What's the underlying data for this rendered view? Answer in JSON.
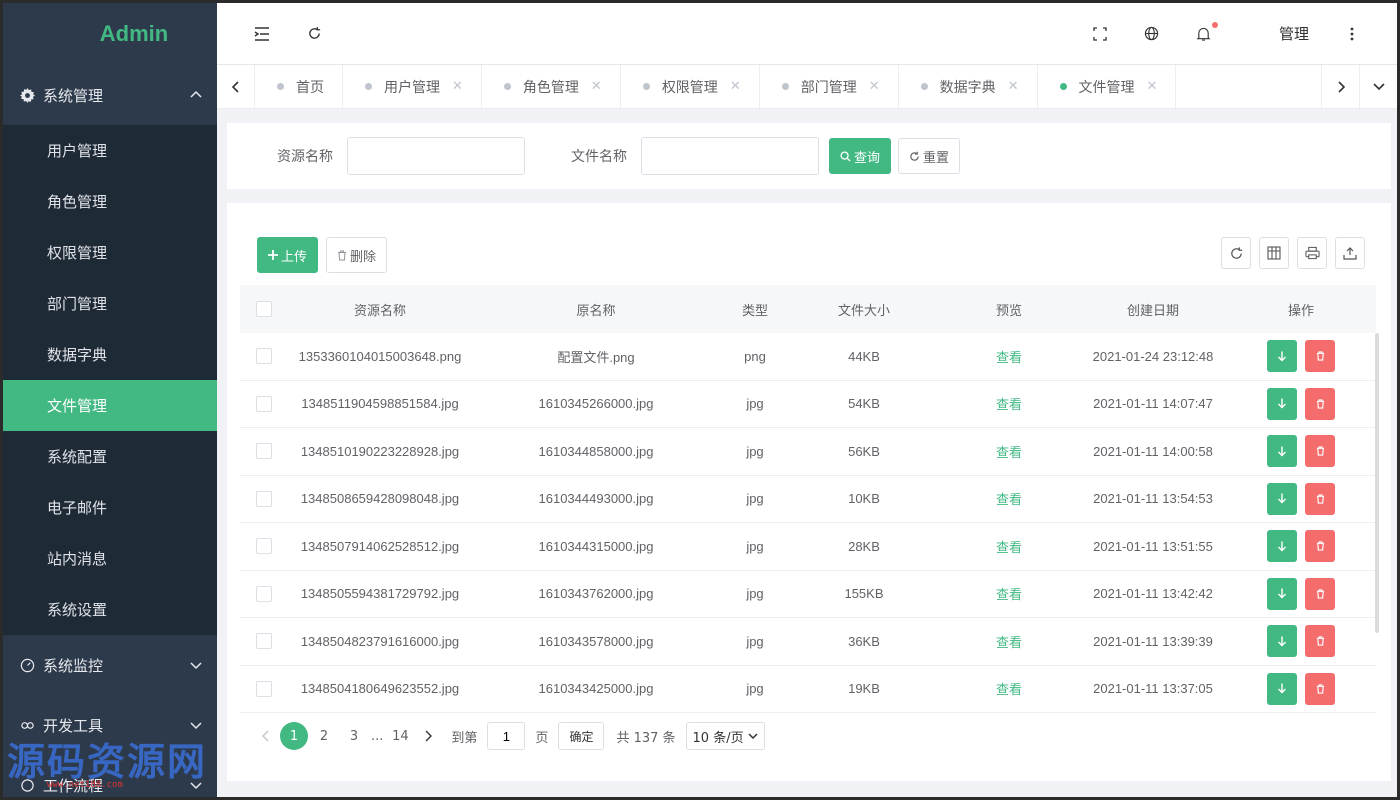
{
  "colors": {
    "accent": "#42b983",
    "danger": "#f56c6c",
    "sidebar_bg": "#2d3a4b",
    "submenu_bg": "#1f2a37"
  },
  "sidebar": {
    "logo": "Admin",
    "groups": [
      {
        "label": "系统管理",
        "icon": "gear-icon",
        "expanded": true
      },
      {
        "label": "系统监控",
        "icon": "gauge-icon",
        "expanded": false
      },
      {
        "label": "开发工具",
        "icon": "link-icon",
        "expanded": false
      },
      {
        "label": "工作流程",
        "icon": "circle-icon",
        "expanded": false
      }
    ],
    "items": [
      {
        "label": "用户管理",
        "active": false
      },
      {
        "label": "角色管理",
        "active": false
      },
      {
        "label": "权限管理",
        "active": false
      },
      {
        "label": "部门管理",
        "active": false
      },
      {
        "label": "数据字典",
        "active": false
      },
      {
        "label": "文件管理",
        "active": true
      },
      {
        "label": "系统配置",
        "active": false
      },
      {
        "label": "电子邮件",
        "active": false
      },
      {
        "label": "站内消息",
        "active": false
      },
      {
        "label": "系统设置",
        "active": false
      }
    ],
    "watermark": "源码资源网",
    "watermark_url": "www.net188.com"
  },
  "header": {
    "user": "管理",
    "icons": [
      "menu-fold-icon",
      "refresh-icon",
      "fullscreen-icon",
      "globe-icon",
      "bell-icon",
      "more-vertical-icon"
    ]
  },
  "tabs": [
    {
      "label": "首页",
      "closable": false,
      "active": false
    },
    {
      "label": "用户管理",
      "closable": true,
      "active": false
    },
    {
      "label": "角色管理",
      "closable": true,
      "active": false
    },
    {
      "label": "权限管理",
      "closable": true,
      "active": false
    },
    {
      "label": "部门管理",
      "closable": true,
      "active": false
    },
    {
      "label": "数据字典",
      "closable": true,
      "active": false
    },
    {
      "label": "文件管理",
      "closable": true,
      "active": true
    }
  ],
  "search": {
    "resource_label": "资源名称",
    "resource_value": "",
    "file_label": "文件名称",
    "file_value": "",
    "query_button": "查询",
    "reset_button": "重置"
  },
  "toolbar": {
    "upload_button": "上传",
    "delete_button": "删除"
  },
  "table": {
    "columns": [
      "资源名称",
      "原名称",
      "类型",
      "文件大小",
      "预览",
      "创建日期",
      "操作"
    ],
    "view_label": "查看",
    "rows": [
      {
        "resource": "1353360104015003648.png",
        "original": "配置文件.png",
        "type": "png",
        "size": "44KB",
        "date": "2021-01-24 23:12:48"
      },
      {
        "resource": "1348511904598851584.jpg",
        "original": "1610345266000.jpg",
        "type": "jpg",
        "size": "54KB",
        "date": "2021-01-11 14:07:47"
      },
      {
        "resource": "1348510190223228928.jpg",
        "original": "1610344858000.jpg",
        "type": "jpg",
        "size": "56KB",
        "date": "2021-01-11 14:00:58"
      },
      {
        "resource": "1348508659428098048.jpg",
        "original": "1610344493000.jpg",
        "type": "jpg",
        "size": "10KB",
        "date": "2021-01-11 13:54:53"
      },
      {
        "resource": "1348507914062528512.jpg",
        "original": "1610344315000.jpg",
        "type": "jpg",
        "size": "28KB",
        "date": "2021-01-11 13:51:55"
      },
      {
        "resource": "1348505594381729792.jpg",
        "original": "1610343762000.jpg",
        "type": "jpg",
        "size": "155KB",
        "date": "2021-01-11 13:42:42"
      },
      {
        "resource": "1348504823791616000.jpg",
        "original": "1610343578000.jpg",
        "type": "jpg",
        "size": "36KB",
        "date": "2021-01-11 13:39:39"
      },
      {
        "resource": "1348504180649623552.jpg",
        "original": "1610343425000.jpg",
        "type": "jpg",
        "size": "19KB",
        "date": "2021-01-11 13:37:05"
      }
    ]
  },
  "pagination": {
    "pages": [
      "1",
      "2",
      "3"
    ],
    "ellipsis": "...",
    "last_page": "14",
    "current": 1,
    "goto_label": "到第",
    "goto_value": "1",
    "page_unit": "页",
    "confirm": "确定",
    "total": "共 137 条",
    "page_size": "10 条/页"
  }
}
